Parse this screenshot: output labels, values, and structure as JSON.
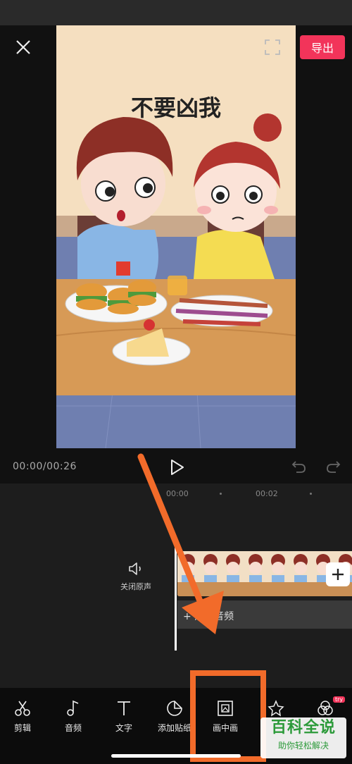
{
  "header": {
    "export_label": "导出"
  },
  "preview": {
    "cartoon_title": "不要凶我"
  },
  "player": {
    "timecode": "00:00/00:26"
  },
  "timeline": {
    "ticks": [
      "00:00",
      "00:02"
    ],
    "mute_label": "关闭原声",
    "audio_label": "+ 添加音频"
  },
  "toolbar": {
    "items": [
      {
        "label": "剪辑",
        "icon": "scissors-icon"
      },
      {
        "label": "音频",
        "icon": "music-note-icon"
      },
      {
        "label": "文字",
        "icon": "text-icon"
      },
      {
        "label": "添加贴纸",
        "icon": "sticker-icon"
      },
      {
        "label": "画中画",
        "icon": "picture-in-picture-icon"
      },
      {
        "label": "",
        "icon": "effects-star-icon"
      },
      {
        "label": "",
        "icon": "filter-icon"
      }
    ],
    "try_badge": "try"
  },
  "watermark": {
    "title": "百科全说",
    "subtitle": "助你轻松解决"
  },
  "colors": {
    "accent": "#f2345a",
    "highlight": "#f26b2a",
    "watermark": "#2c9a3a"
  }
}
